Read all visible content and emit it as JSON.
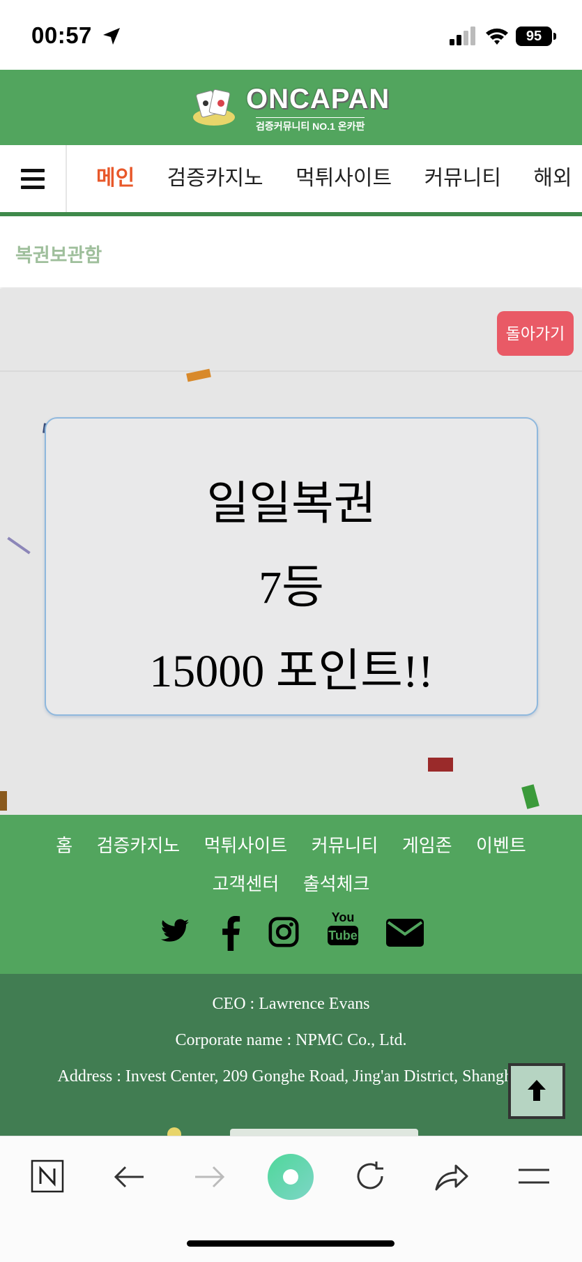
{
  "status_bar": {
    "time": "00:57",
    "battery": "95"
  },
  "header": {
    "logo_text": "ONCAPAN",
    "logo_subtitle": "검증커뮤니티 NO.1 온카판"
  },
  "nav": {
    "items": [
      "메인",
      "검증카지노",
      "먹튀사이트",
      "커뮤니티",
      "해외"
    ],
    "active_color": "#e8582a"
  },
  "page": {
    "title": "복권보관함",
    "back_button": "돌아가기"
  },
  "result": {
    "line1": "일일복권",
    "line2": "7등",
    "line3": "15000 포인트!!"
  },
  "footer": {
    "links_row1": [
      "홈",
      "검증카지노",
      "먹튀사이트",
      "커뮤니티",
      "게임존",
      "이벤트"
    ],
    "links_row2": [
      "고객센터",
      "출석체크"
    ],
    "social_icons": [
      "twitter-icon",
      "facebook-icon",
      "instagram-icon",
      "youtube-icon",
      "mail-icon"
    ],
    "youtube_label_top": "You",
    "youtube_label_bottom": "Tube"
  },
  "company": {
    "ceo": "CEO : Lawrence Evans",
    "corporate_name": "Corporate name : NPMC Co., Ltd.",
    "address": "Address : Invest Center, 209 Gonghe Road, Jing'an District, Shanghai"
  },
  "colors": {
    "brand_green": "#52a55e",
    "dark_green": "#417d52",
    "back_button": "#e95a66",
    "title_text": "#9fbf9c"
  },
  "browser_toolbar": [
    "naver-icon",
    "back-arrow-icon",
    "forward-arrow-icon",
    "green-dot-button",
    "reload-icon",
    "share-icon",
    "menu-icon"
  ]
}
